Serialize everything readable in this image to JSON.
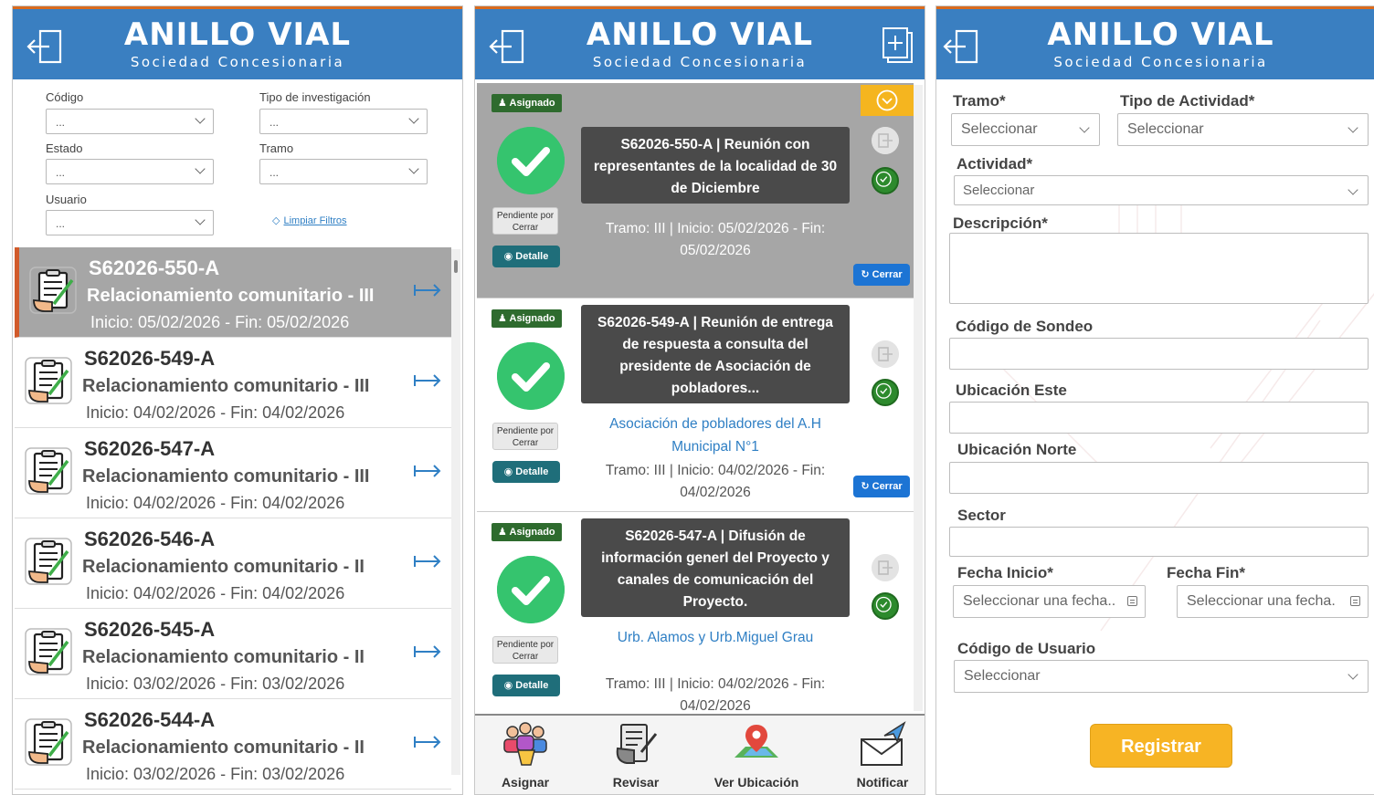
{
  "brand": {
    "title": "ANILLO VIAL",
    "subtitle": "Sociedad Concesionaria"
  },
  "colors": {
    "header": "#3a7fc1",
    "accent": "#d96b1e",
    "success": "#35c46e",
    "button": "#f7b424"
  },
  "filters": {
    "codigo_label": "Código",
    "codigo_value": "...",
    "tipo_label": "Tipo de investigación",
    "tipo_value": "...",
    "estado_label": "Estado",
    "estado_value": "...",
    "tramo_label": "Tramo",
    "tramo_value": "...",
    "usuario_label": "Usuario",
    "usuario_value": "...",
    "clear_label": "Limpiar Filtros"
  },
  "list": [
    {
      "code": "S62026-550-A",
      "title": "Relacionamiento comunitario - III",
      "dates": "Inicio: 05/02/2026 - Fin: 05/02/2026"
    },
    {
      "code": "S62026-549-A",
      "title": "Relacionamiento comunitario - III",
      "dates": "Inicio: 04/02/2026 - Fin: 04/02/2026"
    },
    {
      "code": "S62026-547-A",
      "title": "Relacionamiento comunitario - III",
      "dates": "Inicio: 04/02/2026 - Fin: 04/02/2026"
    },
    {
      "code": "S62026-546-A",
      "title": "Relacionamiento comunitario - II",
      "dates": "Inicio: 04/02/2026 - Fin: 04/02/2026"
    },
    {
      "code": "S62026-545-A",
      "title": "Relacionamiento comunitario - II",
      "dates": "Inicio: 03/02/2026 - Fin: 03/02/2026"
    },
    {
      "code": "S62026-544-A",
      "title": "Relacionamiento comunitario - II",
      "dates": "Inicio: 03/02/2026 - Fin: 03/02/2026"
    }
  ],
  "cards": [
    {
      "badge": "Asignado",
      "title": "S62026-550-A | Reunión con representantes de la localidad de 30 de Diciembre",
      "location": "",
      "meta": "Tramo: III | Inicio: 05/02/2026 - Fin: 05/02/2026",
      "pending": "Pendiente por Cerrar",
      "detail": "Detalle",
      "close": "Cerrar"
    },
    {
      "badge": "Asignado",
      "title": "S62026-549-A | Reunión de entrega de respuesta a consulta del presidente de Asociación de pobladores...",
      "location": "Asociación de pobladores del A.H Municipal N°1",
      "meta": "Tramo: III | Inicio: 04/02/2026 - Fin: 04/02/2026",
      "pending": "Pendiente por Cerrar",
      "detail": "Detalle",
      "close": "Cerrar"
    },
    {
      "badge": "Asignado",
      "title": "S62026-547-A | Difusión de información generl del Proyecto y canales de comunicación del Proyecto.",
      "location": "Urb. Alamos y Urb.Miguel Grau",
      "meta": "Tramo: III | Inicio: 04/02/2026 - Fin: 04/02/2026",
      "pending": "Pendiente por Cerrar",
      "detail": "Detalle",
      "close": ""
    }
  ],
  "nav": {
    "asignar": "Asignar",
    "revisar": "Revisar",
    "ubicacion": "Ver Ubicación",
    "notificar": "Notificar"
  },
  "form": {
    "tramo_label": "Tramo*",
    "tramo_value": "Seleccionar",
    "tipo_label": "Tipo de Actividad*",
    "tipo_value": "Seleccionar",
    "actividad_label": "Actividad*",
    "actividad_value": "Seleccionar",
    "descripcion_label": "Descripción*",
    "sondeo_label": "Código de Sondeo",
    "este_label": "Ubicación Este",
    "norte_label": "Ubicación Norte",
    "sector_label": "Sector",
    "inicio_label": "Fecha Inicio*",
    "inicio_placeholder": "Seleccionar una fecha..",
    "fin_label": "Fecha Fin*",
    "fin_placeholder": "Seleccionar una fecha.",
    "usuario_label": "Código de Usuario",
    "usuario_value": "Seleccionar",
    "submit": "Registrar"
  }
}
